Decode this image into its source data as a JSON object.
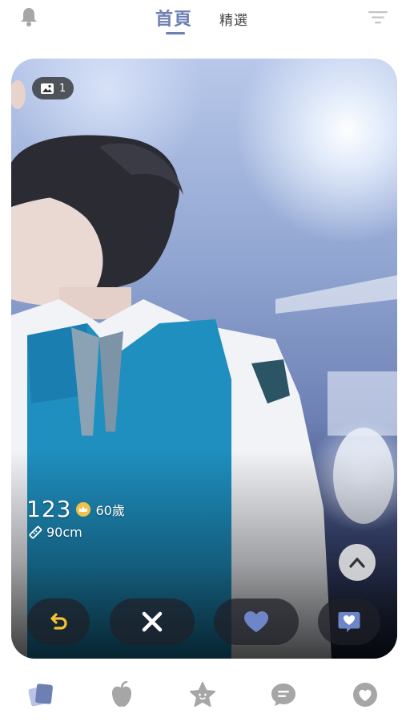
{
  "header": {
    "tabs": [
      {
        "label": "首頁",
        "active": true
      },
      {
        "label": "精選",
        "active": false
      }
    ],
    "left_icon": "bell-icon",
    "right_icon": "filter-icon"
  },
  "card": {
    "photo_count": "1",
    "name": "123",
    "age": "60歲",
    "height": "90cm",
    "badge_icon": "crown-badge-icon"
  },
  "actions": [
    {
      "name": "undo",
      "icon": "undo-icon",
      "color": "#f2c230"
    },
    {
      "name": "pass",
      "icon": "close-icon",
      "color": "#ffffff"
    },
    {
      "name": "like",
      "icon": "heart-icon",
      "color": "#6e86c8"
    },
    {
      "name": "super-like",
      "icon": "heart-message-icon",
      "color": "#6e86c8"
    }
  ],
  "bottom_nav": [
    {
      "name": "cards",
      "icon": "cards-icon",
      "active": true
    },
    {
      "name": "moments",
      "icon": "apple-icon",
      "active": false
    },
    {
      "name": "star",
      "icon": "star-face-icon",
      "active": false
    },
    {
      "name": "chat",
      "icon": "chat-bubble-icon",
      "active": false
    },
    {
      "name": "likes",
      "icon": "heart-circle-icon",
      "active": false
    }
  ],
  "colors": {
    "accent": "#6e7fb4",
    "inactive_icon": "#a6a6a6",
    "undo": "#f2c230",
    "like": "#6e86c8"
  }
}
